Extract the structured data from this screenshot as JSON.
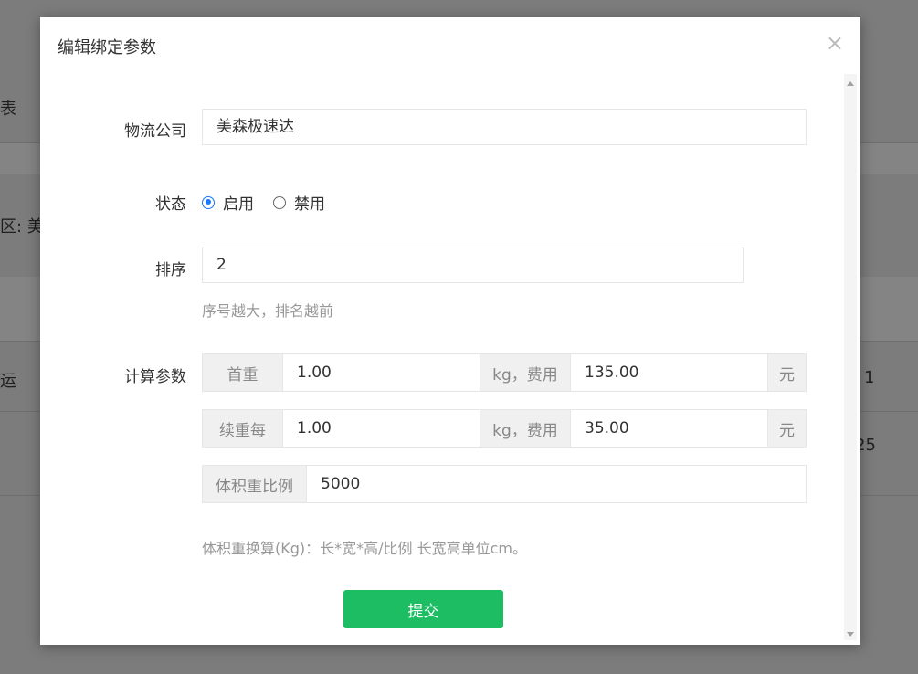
{
  "background": {
    "fragment_1": "表",
    "fragment_2": "区: 美",
    "fragment_3": "运",
    "fragment_4": "1",
    "fragment_5": "25"
  },
  "modal": {
    "title": "编辑绑定参数",
    "close_glyph": "×"
  },
  "form": {
    "company": {
      "label": "物流公司",
      "value": "美森极速达"
    },
    "status": {
      "label": "状态",
      "options": [
        {
          "label": "启用",
          "checked": true
        },
        {
          "label": "禁用",
          "checked": false
        }
      ]
    },
    "sort": {
      "label": "排序",
      "value": "2",
      "help": "序号越大，排名越前"
    },
    "params": {
      "label": "计算参数",
      "first_weight": {
        "prefix": "首重",
        "weight": "1.00",
        "mid": "kg，费用",
        "fee": "135.00",
        "suffix": "元"
      },
      "additional_weight": {
        "prefix": "续重每",
        "weight": "1.00",
        "mid": "kg，费用",
        "fee": "35.00",
        "suffix": "元"
      },
      "volume_ratio": {
        "prefix": "体积重比例",
        "value": "5000"
      },
      "help": "体积重换算(Kg)：长*宽*高/比例 长宽高单位cm。"
    },
    "submit_label": "提交"
  },
  "colors": {
    "primary_button": "#1dbe63",
    "radio_checked": "#1677ff",
    "overlay": "#7c7c7c"
  }
}
